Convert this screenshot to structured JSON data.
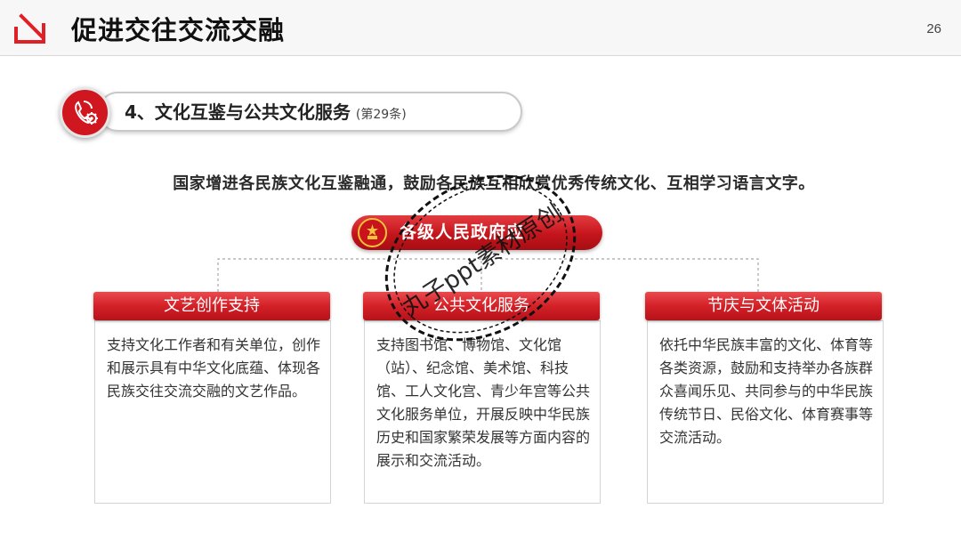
{
  "header": {
    "title": "促进交往交流交融",
    "page_number": "26"
  },
  "section": {
    "title": "4、文化互鉴与公共文化服务",
    "subtitle": "(第29条)"
  },
  "main_statement": "国家增进各民族文化互鉴融通，鼓励各民族互相欣赏优秀传统文化、互相学习语言文字。",
  "banner": {
    "label": "各级人民政府应"
  },
  "cards": [
    {
      "title": "文艺创作支持",
      "body": "支持文化工作者和有关单位，创作和展示具有中华文化底蕴、体现各民族交往交流交融的文艺作品。"
    },
    {
      "title": "公共文化服务",
      "body": "支持图书馆、博物馆、文化馆（站）、纪念馆、美术馆、科技馆、工人文化宫、青少年宫等公共文化服务单位，开展反映中华民族历史和国家繁荣发展等方面内容的展示和交流活动。"
    },
    {
      "title": "节庆与文体活动",
      "body": "依托中华民族丰富的文化、体育等各类资源，鼓励和支持举办各族群众喜闻乐见、共同参与的中华民族传统节日、民俗文化、体育赛事等交流活动。"
    }
  ],
  "watermark": "丸子ppt素材原创",
  "colors": {
    "accent_red": "#d0161e",
    "header_bg": "#f7f7f7"
  },
  "icons": {
    "header": "arrow-down-right-icon",
    "section": "phone-gear-icon",
    "banner": "national-emblem-icon"
  }
}
